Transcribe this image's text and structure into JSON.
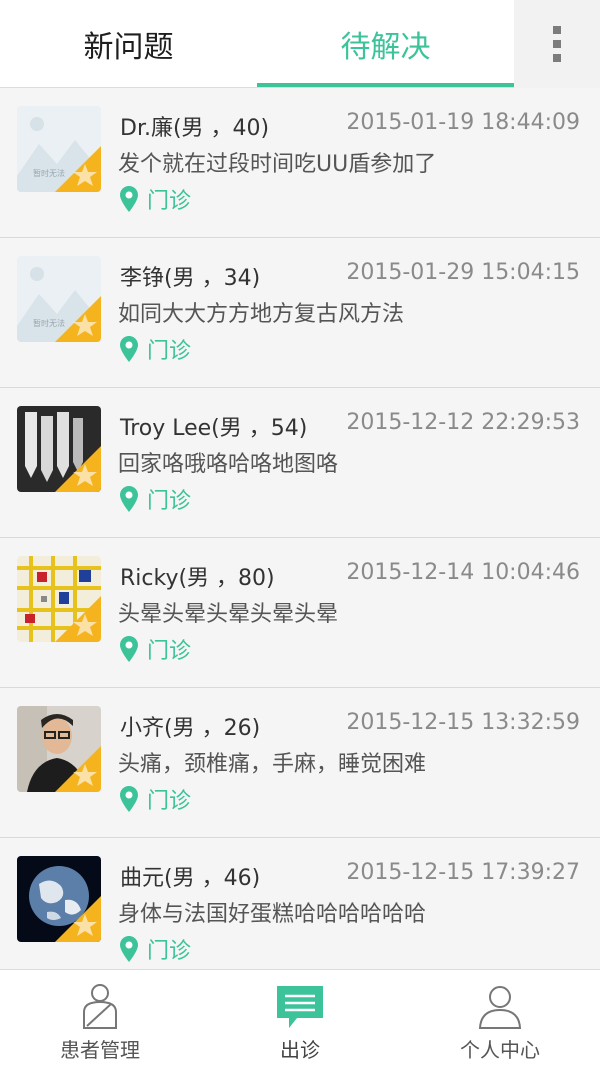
{
  "tabs": {
    "new": "新问题",
    "pending": "待解决",
    "active_color": "#3cc39a"
  },
  "questions": [
    {
      "name": "Dr.廉(男 ，40)",
      "time": "2015-01-19 18:44:09",
      "text": "发个就在过段时间吃UU盾参加了",
      "clinic": "门诊",
      "avatar": "placeholder",
      "placeholder_text": "暂时无法"
    },
    {
      "name": "李铮(男 ，34)",
      "time": "2015-01-29 15:04:15",
      "text": "如同大大方方地方复古风方法",
      "clinic": "门诊",
      "avatar": "placeholder",
      "placeholder_text": "暂时无法"
    },
    {
      "name": "Troy Lee(男 ，54)",
      "time": "2015-12-12 22:29:53",
      "text": "回家咯哦咯哈咯地图咯",
      "clinic": "门诊",
      "avatar": "logo-photo"
    },
    {
      "name": "Ricky(男 ，80)",
      "time": "2015-12-14 10:04:46",
      "text": "头晕头晕头晕头晕头晕",
      "clinic": "门诊",
      "avatar": "mondrian-grid"
    },
    {
      "name": "小齐(男 ，26)",
      "time": "2015-12-15 13:32:59",
      "text": "头痛，颈椎痛，手麻，睡觉困难",
      "clinic": "门诊",
      "avatar": "person-photo"
    },
    {
      "name": "曲元(男 ，46)",
      "time": "2015-12-15 17:39:27",
      "text": "身体与法国好蛋糕哈哈哈哈哈哈",
      "clinic": "门诊",
      "avatar": "earth-photo"
    }
  ],
  "bottom_nav": [
    {
      "label": "患者管理",
      "icon": "patient-icon"
    },
    {
      "label": "出诊",
      "icon": "chat-icon"
    },
    {
      "label": "个人中心",
      "icon": "person-icon"
    }
  ]
}
